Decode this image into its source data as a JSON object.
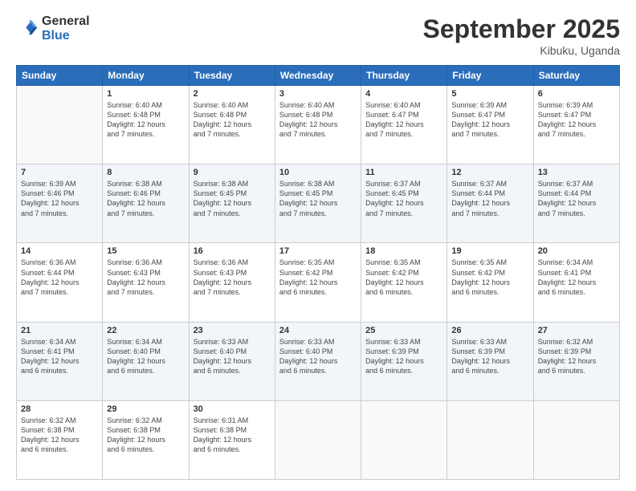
{
  "logo": {
    "general": "General",
    "blue": "Blue"
  },
  "title": "September 2025",
  "location": "Kibuku, Uganda",
  "days_header": [
    "Sunday",
    "Monday",
    "Tuesday",
    "Wednesday",
    "Thursday",
    "Friday",
    "Saturday"
  ],
  "weeks": [
    [
      {
        "num": "",
        "info": ""
      },
      {
        "num": "1",
        "info": "Sunrise: 6:40 AM\nSunset: 6:48 PM\nDaylight: 12 hours\nand 7 minutes."
      },
      {
        "num": "2",
        "info": "Sunrise: 6:40 AM\nSunset: 6:48 PM\nDaylight: 12 hours\nand 7 minutes."
      },
      {
        "num": "3",
        "info": "Sunrise: 6:40 AM\nSunset: 6:48 PM\nDaylight: 12 hours\nand 7 minutes."
      },
      {
        "num": "4",
        "info": "Sunrise: 6:40 AM\nSunset: 6:47 PM\nDaylight: 12 hours\nand 7 minutes."
      },
      {
        "num": "5",
        "info": "Sunrise: 6:39 AM\nSunset: 6:47 PM\nDaylight: 12 hours\nand 7 minutes."
      },
      {
        "num": "6",
        "info": "Sunrise: 6:39 AM\nSunset: 6:47 PM\nDaylight: 12 hours\nand 7 minutes."
      }
    ],
    [
      {
        "num": "7",
        "info": "Sunrise: 6:39 AM\nSunset: 6:46 PM\nDaylight: 12 hours\nand 7 minutes."
      },
      {
        "num": "8",
        "info": "Sunrise: 6:38 AM\nSunset: 6:46 PM\nDaylight: 12 hours\nand 7 minutes."
      },
      {
        "num": "9",
        "info": "Sunrise: 6:38 AM\nSunset: 6:45 PM\nDaylight: 12 hours\nand 7 minutes."
      },
      {
        "num": "10",
        "info": "Sunrise: 6:38 AM\nSunset: 6:45 PM\nDaylight: 12 hours\nand 7 minutes."
      },
      {
        "num": "11",
        "info": "Sunrise: 6:37 AM\nSunset: 6:45 PM\nDaylight: 12 hours\nand 7 minutes."
      },
      {
        "num": "12",
        "info": "Sunrise: 6:37 AM\nSunset: 6:44 PM\nDaylight: 12 hours\nand 7 minutes."
      },
      {
        "num": "13",
        "info": "Sunrise: 6:37 AM\nSunset: 6:44 PM\nDaylight: 12 hours\nand 7 minutes."
      }
    ],
    [
      {
        "num": "14",
        "info": "Sunrise: 6:36 AM\nSunset: 6:44 PM\nDaylight: 12 hours\nand 7 minutes."
      },
      {
        "num": "15",
        "info": "Sunrise: 6:36 AM\nSunset: 6:43 PM\nDaylight: 12 hours\nand 7 minutes."
      },
      {
        "num": "16",
        "info": "Sunrise: 6:36 AM\nSunset: 6:43 PM\nDaylight: 12 hours\nand 7 minutes."
      },
      {
        "num": "17",
        "info": "Sunrise: 6:35 AM\nSunset: 6:42 PM\nDaylight: 12 hours\nand 6 minutes."
      },
      {
        "num": "18",
        "info": "Sunrise: 6:35 AM\nSunset: 6:42 PM\nDaylight: 12 hours\nand 6 minutes."
      },
      {
        "num": "19",
        "info": "Sunrise: 6:35 AM\nSunset: 6:42 PM\nDaylight: 12 hours\nand 6 minutes."
      },
      {
        "num": "20",
        "info": "Sunrise: 6:34 AM\nSunset: 6:41 PM\nDaylight: 12 hours\nand 6 minutes."
      }
    ],
    [
      {
        "num": "21",
        "info": "Sunrise: 6:34 AM\nSunset: 6:41 PM\nDaylight: 12 hours\nand 6 minutes."
      },
      {
        "num": "22",
        "info": "Sunrise: 6:34 AM\nSunset: 6:40 PM\nDaylight: 12 hours\nand 6 minutes."
      },
      {
        "num": "23",
        "info": "Sunrise: 6:33 AM\nSunset: 6:40 PM\nDaylight: 12 hours\nand 6 minutes."
      },
      {
        "num": "24",
        "info": "Sunrise: 6:33 AM\nSunset: 6:40 PM\nDaylight: 12 hours\nand 6 minutes."
      },
      {
        "num": "25",
        "info": "Sunrise: 6:33 AM\nSunset: 6:39 PM\nDaylight: 12 hours\nand 6 minutes."
      },
      {
        "num": "26",
        "info": "Sunrise: 6:33 AM\nSunset: 6:39 PM\nDaylight: 12 hours\nand 6 minutes."
      },
      {
        "num": "27",
        "info": "Sunrise: 6:32 AM\nSunset: 6:39 PM\nDaylight: 12 hours\nand 6 minutes."
      }
    ],
    [
      {
        "num": "28",
        "info": "Sunrise: 6:32 AM\nSunset: 6:38 PM\nDaylight: 12 hours\nand 6 minutes."
      },
      {
        "num": "29",
        "info": "Sunrise: 6:32 AM\nSunset: 6:38 PM\nDaylight: 12 hours\nand 6 minutes."
      },
      {
        "num": "30",
        "info": "Sunrise: 6:31 AM\nSunset: 6:38 PM\nDaylight: 12 hours\nand 6 minutes."
      },
      {
        "num": "",
        "info": ""
      },
      {
        "num": "",
        "info": ""
      },
      {
        "num": "",
        "info": ""
      },
      {
        "num": "",
        "info": ""
      }
    ]
  ]
}
